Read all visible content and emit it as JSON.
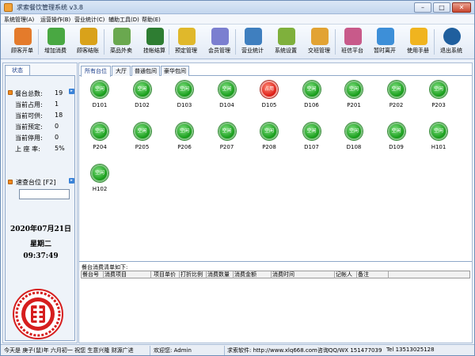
{
  "window": {
    "title": "求索餐饮管理系统 v3.8"
  },
  "menu": [
    "系统管理(A)",
    "运营操作(B)",
    "营业统计(C)",
    "辅助工具(D)",
    "帮助(E)"
  ],
  "toolbar": [
    {
      "label": "顾客开单",
      "icon": "clipboard-icon",
      "color": "#e47b2b"
    },
    {
      "label": "增加消费",
      "icon": "add-order-icon",
      "color": "#49a842"
    },
    {
      "label": "顾客结账",
      "icon": "coins-icon",
      "color": "#d9a21a"
    },
    {
      "label": "菜品外卖",
      "icon": "takeout-icon",
      "color": "#6aa84f"
    },
    {
      "label": "挂帐结算",
      "icon": "credit-icon",
      "color": "#2e7d32"
    },
    {
      "label": "预定管理",
      "icon": "booking-icon",
      "color": "#e0b82b"
    },
    {
      "label": "会员管理",
      "icon": "member-icon",
      "color": "#7b7fd0"
    },
    {
      "label": "营业统计",
      "icon": "stats-icon",
      "color": "#3f7fbf"
    },
    {
      "label": "系统设置",
      "icon": "settings-icon",
      "color": "#7fb03c"
    },
    {
      "label": "交班管理",
      "icon": "handover-icon",
      "color": "#e2a333"
    },
    {
      "label": "班信平台",
      "icon": "message-icon",
      "color": "#c85a8a"
    },
    {
      "label": "暂时离开",
      "icon": "away-icon",
      "color": "#3d8fd8"
    },
    {
      "label": "使用手册",
      "icon": "help-icon",
      "color": "#f0b41f"
    },
    {
      "label": "退出系统",
      "icon": "power-icon",
      "color": "#1f5f9e"
    }
  ],
  "left": {
    "tab": "状态",
    "stats": [
      {
        "label": "餐台总数:",
        "value": "19"
      },
      {
        "label": "当前占用:",
        "value": "1"
      },
      {
        "label": "当前可供:",
        "value": "18"
      },
      {
        "label": "当前预定:",
        "value": "0"
      },
      {
        "label": "当前停用:",
        "value": "0"
      },
      {
        "label": "上 座 率:",
        "value": "5%"
      }
    ],
    "quick_search": "速查台位 [F2]",
    "date": "2020年07月21日",
    "weekday": "星期二",
    "time": "09:37:49"
  },
  "tabs": [
    "所有台位",
    "大厅",
    "普通包间",
    "豪华包间"
  ],
  "tables": [
    {
      "name": "D101",
      "status": "空闲"
    },
    {
      "name": "D102",
      "status": "空闲"
    },
    {
      "name": "D103",
      "status": "空闲"
    },
    {
      "name": "D104",
      "status": "空闲"
    },
    {
      "name": "D105",
      "status": "占用"
    },
    {
      "name": "D106",
      "status": "空闲"
    },
    {
      "name": "P201",
      "status": "空闲"
    },
    {
      "name": "P202",
      "status": "空闲"
    },
    {
      "name": "P203",
      "status": "空闲"
    },
    {
      "name": "P204",
      "status": "空闲"
    },
    {
      "name": "P205",
      "status": "空闲"
    },
    {
      "name": "P206",
      "status": "空闲"
    },
    {
      "name": "P207",
      "status": "空闲"
    },
    {
      "name": "P208",
      "status": "空闲"
    },
    {
      "name": "D107",
      "status": "空闲"
    },
    {
      "name": "D108",
      "status": "空闲"
    },
    {
      "name": "D109",
      "status": "空闲"
    },
    {
      "name": "H101",
      "status": "空闲"
    },
    {
      "name": "H102",
      "status": "空闲"
    }
  ],
  "detail": {
    "title": "餐台消费清单如下:",
    "columns": [
      "餐台号",
      "消费项目",
      "项目单价",
      "打折比例",
      "消费数量",
      "消费金额",
      "消费时间",
      "记帐人",
      "备注"
    ]
  },
  "status": {
    "lunar": "今天是 庚子(鼠)年 六月初一 祝您 生意兴隆 财源广进",
    "welcome": "欢迎您: Admin",
    "software": "求索软件: http://www.xlq668.com",
    "contact": "咨询QQ/WX 151477039",
    "tel": "Tel 13513025128"
  },
  "seal_text": "招财进宝"
}
